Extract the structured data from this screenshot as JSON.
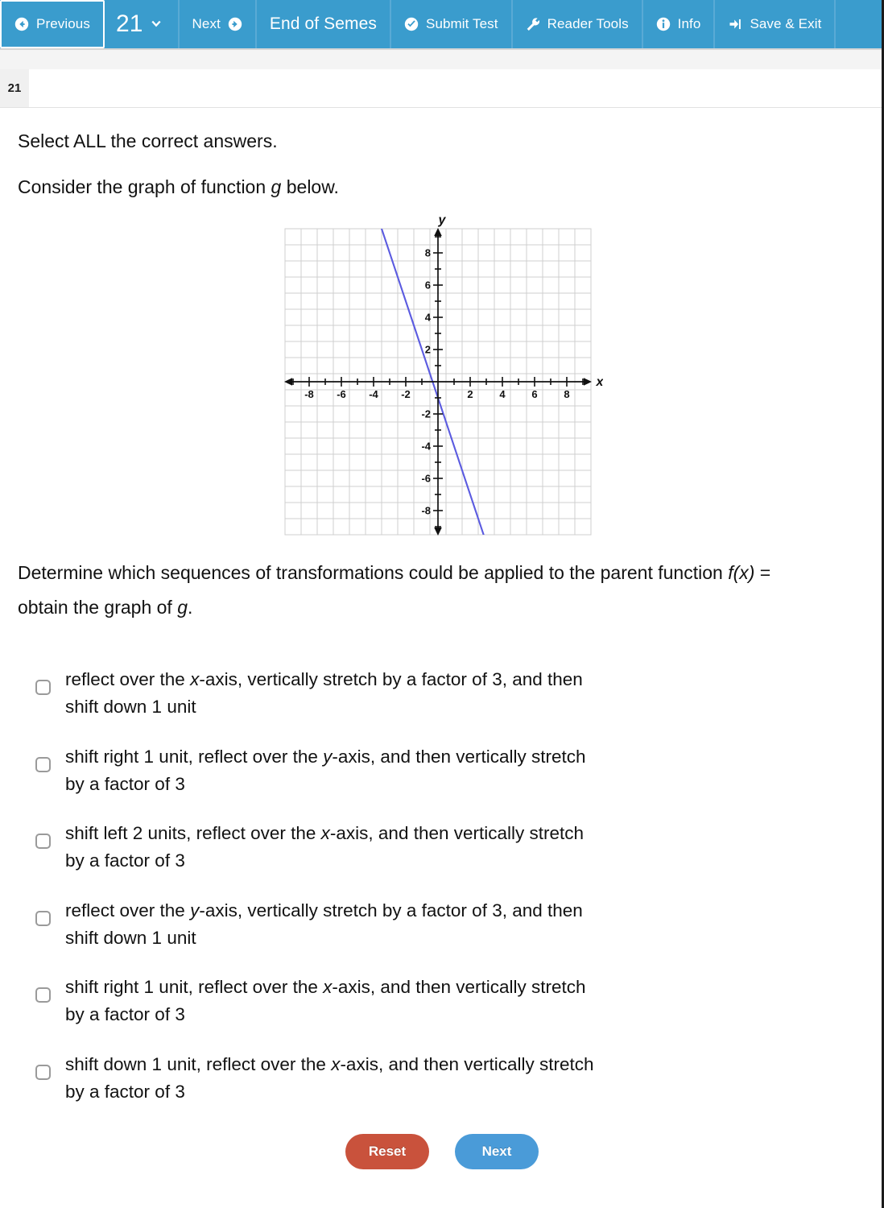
{
  "toolbar": {
    "buttons": [
      {
        "label": "Previous",
        "icon": "arrow-left-circle-icon",
        "name": "previous-button",
        "focused": true
      },
      {
        "label": "21",
        "icon": "chevron-down-icon",
        "name": "question-number-dropdown",
        "style": "pagenum"
      },
      {
        "label": "Next",
        "icon": "arrow-right-circle-icon",
        "name": "next-button"
      },
      {
        "label": "End of Semes",
        "icon": "none",
        "name": "end-of-semester-button",
        "style": "big"
      },
      {
        "label": "Submit Test",
        "icon": "check-circle-icon",
        "name": "submit-test-button"
      },
      {
        "label": "Reader Tools",
        "icon": "wrench-icon",
        "name": "reader-tools-button"
      },
      {
        "label": "Info",
        "icon": "info-circle-icon",
        "name": "info-button"
      },
      {
        "label": "Save & Exit",
        "icon": "sign-out-icon",
        "name": "save-and-exit-button"
      }
    ]
  },
  "question_tab": {
    "number": "21"
  },
  "question": {
    "instruction": "Select ALL the correct answers.",
    "prompt_1": "Consider the graph of function ",
    "prompt_1_italic": "g",
    "prompt_1_end": " below.",
    "prompt_2_a": "Determine which sequences of transformations could be applied to the parent function ",
    "prompt_2_italic": "f(x)",
    "prompt_2_b": " =",
    "prompt_2_line2": "obtain the graph of ",
    "prompt_2_line2_italic": "g",
    "prompt_2_line2_end": "."
  },
  "options": [
    {
      "id": "opt-1",
      "checked": false,
      "line1_a": "reflect over the ",
      "line1_i": "x",
      "line1_b": "-axis, vertically stretch by a factor of 3, and then",
      "line2": "shift down 1 unit"
    },
    {
      "id": "opt-2",
      "checked": false,
      "line1_a": "shift right 1 unit, reflect over the ",
      "line1_i": "y",
      "line1_b": "-axis, and then vertically stretch",
      "line2": "by a factor of 3"
    },
    {
      "id": "opt-3",
      "checked": false,
      "line1_a": "shift left 2 units, reflect over the ",
      "line1_i": "x",
      "line1_b": "-axis, and then vertically stretch",
      "line2": "by a factor of 3"
    },
    {
      "id": "opt-4",
      "checked": false,
      "line1_a": "reflect over the ",
      "line1_i": "y",
      "line1_b": "-axis, vertically stretch by a factor of 3, and then",
      "line2": "shift down 1 unit"
    },
    {
      "id": "opt-5",
      "checked": false,
      "line1_a": "shift right 1 unit, reflect over the ",
      "line1_i": "x",
      "line1_b": "-axis, and then vertically stretch",
      "line2": "by a factor of 3"
    },
    {
      "id": "opt-6",
      "checked": false,
      "line1_a": "shift down 1 unit, reflect over the ",
      "line1_i": "x",
      "line1_b": "-axis, and then vertically stretch",
      "line2": "by a factor of 3"
    }
  ],
  "footer": {
    "reset_label": "Reset",
    "next_label": "Next"
  },
  "colors": {
    "toolbar_blue": "#3a9ccd",
    "next_blue": "#4a9bd8",
    "reset_red": "#c9523c",
    "line_purple": "#5b5be0",
    "grid_gray": "#cfcfcf"
  },
  "chart_data": {
    "type": "line",
    "title": "",
    "xlabel": "x",
    "ylabel": "y",
    "xlim": [
      -9.5,
      9.5
    ],
    "ylim": [
      -9.5,
      9.5
    ],
    "xticks": [
      -8,
      -6,
      -4,
      -2,
      2,
      4,
      6,
      8
    ],
    "yticks": [
      8,
      6,
      4,
      2,
      -2,
      -4,
      -6,
      -8
    ],
    "xtick_labels": [
      "-8",
      "-6",
      "-4",
      "-2",
      "2",
      "4",
      "6",
      "8"
    ],
    "ytick_labels": [
      "8",
      "6",
      "4",
      "2",
      "-2",
      "-4",
      "-6",
      "-8"
    ],
    "minor_tick_step": 1,
    "grid": true,
    "legend": null,
    "series": [
      {
        "name": "g",
        "equation": "y = -3x - 1",
        "slope": -3,
        "intercept": -1,
        "color": "#5b5be0",
        "x": [
          -3.17,
          2.83
        ],
        "y": [
          8.5,
          -9.5
        ]
      }
    ]
  }
}
